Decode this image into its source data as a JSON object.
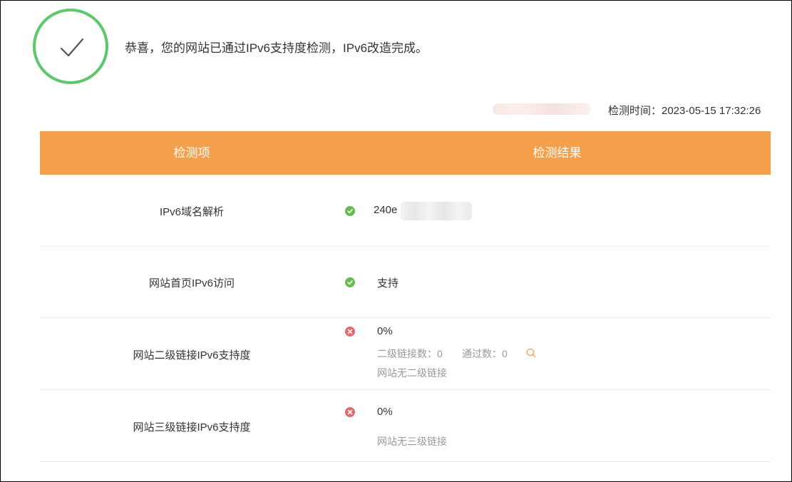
{
  "banner": {
    "message": "恭喜，您的网站已通过IPv6支持度检测，IPv6改造完成。",
    "check_time": "检测时间：2023-05-15 17:32:26"
  },
  "table": {
    "headers": [
      "检测项",
      "检测结果"
    ],
    "rows": [
      {
        "name": "IPv6域名解析",
        "status": "pass",
        "result": "240e"
      },
      {
        "name": "网站首页IPv6访问",
        "status": "pass",
        "result": "支持"
      },
      {
        "name": "网站二级链接IPv6支持度",
        "status": "fail",
        "result": "0%",
        "link_count_label": "二级链接数：0",
        "pass_count_label": "通过数：0",
        "note": "网站无二级链接"
      },
      {
        "name": "网站三级链接IPv6支持度",
        "status": "fail",
        "result": "0%",
        "note": "网站无三级链接"
      }
    ]
  },
  "colors": {
    "header_bg": "#f39f4b",
    "success_green": "#5cc86a",
    "pass_icon": "#67bc4e",
    "fail_icon": "#e06c6c"
  },
  "icons": {
    "badge": "check-icon",
    "pass": "check-circle-icon",
    "fail": "close-circle-icon",
    "detail": "search-icon"
  }
}
